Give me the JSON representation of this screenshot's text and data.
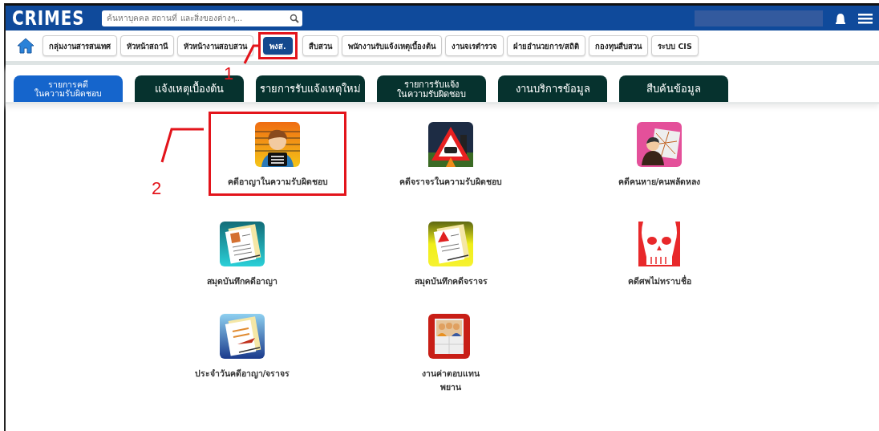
{
  "header": {
    "logo": "CRIMES",
    "search": {
      "placeholder": "ค้นหาบุคคล สถานที่ และสิ่งของต่างๆ..."
    }
  },
  "nav": [
    {
      "label": "กลุ่มงานสารสนเทศ",
      "selected": false
    },
    {
      "label": "หัวหน้าสถานี",
      "selected": false
    },
    {
      "label": "หัวหน้างานสอบสวน",
      "selected": false
    },
    {
      "label": "พงส.",
      "selected": true,
      "callout": "1"
    },
    {
      "label": "สืบสวน",
      "selected": false
    },
    {
      "label": "พนักงานรับแจ้งเหตุเบื้องต้น",
      "selected": false
    },
    {
      "label": "งานจเรตำรวจ",
      "selected": false
    },
    {
      "label": "ฝ่ายอำนวยการ/สถิติ",
      "selected": false
    },
    {
      "label": "กองทุนสืบสวน",
      "selected": false
    },
    {
      "label": "ระบบ CIS",
      "selected": false
    }
  ],
  "tabs": [
    {
      "label": "รายการคดี\nในความรับผิดชอบ",
      "selected": true
    },
    {
      "label": "แจ้งเหตุเบื้องต้น",
      "selected": false
    },
    {
      "label": "รายการรับแจ้งเหตุใหม่",
      "selected": false
    },
    {
      "label": "รายการรับแจ้ง\nในความรับผิดชอบ",
      "selected": false
    },
    {
      "label": "งานบริการข้อมูล",
      "selected": false
    },
    {
      "label": "สืบค้นข้อมูล",
      "selected": false
    }
  ],
  "apps": [
    {
      "label": "คดีอาญาในความรับผิดชอบ",
      "kind": "mugshot",
      "callout": "2"
    },
    {
      "label": "คดีจราจรในความรับผิดชอบ",
      "kind": "traffic"
    },
    {
      "label": "คดีคนหาย/คนพลัดหลง",
      "kind": "missing"
    },
    {
      "label": "สมุดบันทึกคดีอาญา",
      "kind": "notebook-teal"
    },
    {
      "label": "สมุดบันทึกคดีจราจร",
      "kind": "notebook-yellow"
    },
    {
      "label": "คดีศพไม่ทราบชื่อ",
      "kind": "skull"
    },
    {
      "label": "ประจำวันคดีอาญา/จราจร",
      "kind": "notebook-blue"
    },
    {
      "label": "งานค่าตอบแทน\nพยาน",
      "kind": "witness"
    }
  ]
}
